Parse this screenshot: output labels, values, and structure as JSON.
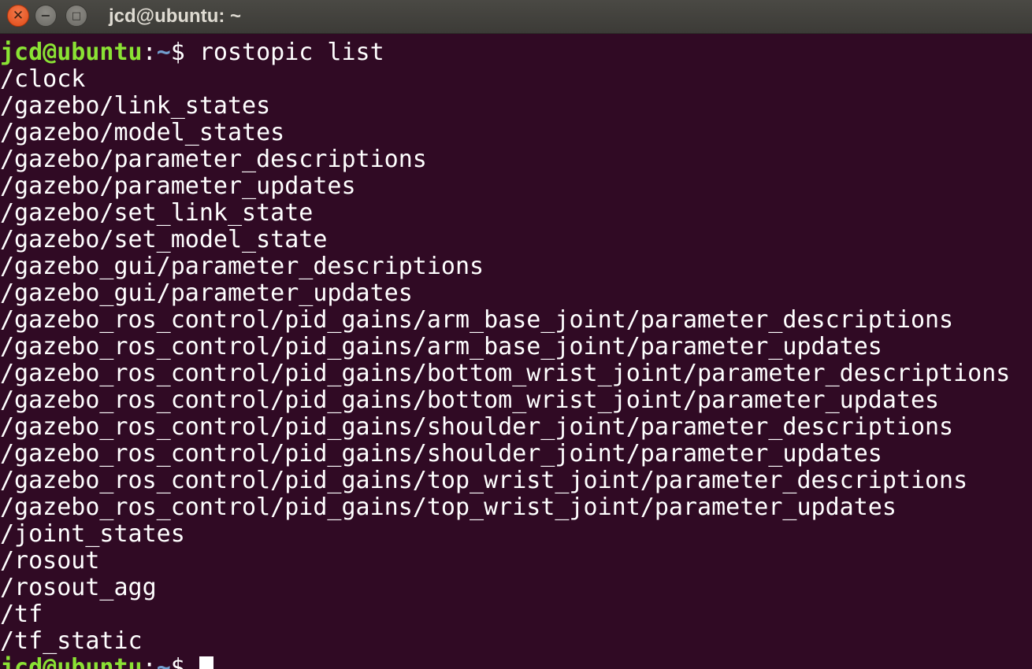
{
  "window": {
    "title": "jcd@ubuntu: ~",
    "controls": {
      "close_glyph": "✕",
      "minimize_glyph": "−",
      "maximize_glyph": "□"
    }
  },
  "prompt": {
    "user_host": "jcd@ubuntu",
    "colon": ":",
    "path": "~",
    "symbol": "$ "
  },
  "command": "rostopic list",
  "output_lines": [
    "/clock",
    "/gazebo/link_states",
    "/gazebo/model_states",
    "/gazebo/parameter_descriptions",
    "/gazebo/parameter_updates",
    "/gazebo/set_link_state",
    "/gazebo/set_model_state",
    "/gazebo_gui/parameter_descriptions",
    "/gazebo_gui/parameter_updates",
    "/gazebo_ros_control/pid_gains/arm_base_joint/parameter_descriptions",
    "/gazebo_ros_control/pid_gains/arm_base_joint/parameter_updates",
    "/gazebo_ros_control/pid_gains/bottom_wrist_joint/parameter_descriptions",
    "/gazebo_ros_control/pid_gains/bottom_wrist_joint/parameter_updates",
    "/gazebo_ros_control/pid_gains/shoulder_joint/parameter_descriptions",
    "/gazebo_ros_control/pid_gains/shoulder_joint/parameter_updates",
    "/gazebo_ros_control/pid_gains/top_wrist_joint/parameter_descriptions",
    "/gazebo_ros_control/pid_gains/top_wrist_joint/parameter_updates",
    "/joint_states",
    "/rosout",
    "/rosout_agg",
    "/tf",
    "/tf_static"
  ],
  "colors": {
    "background": "#300a24",
    "text": "#ffffff",
    "prompt_user": "#8ae234",
    "prompt_path": "#729fcf",
    "close_button": "#df4a16"
  }
}
